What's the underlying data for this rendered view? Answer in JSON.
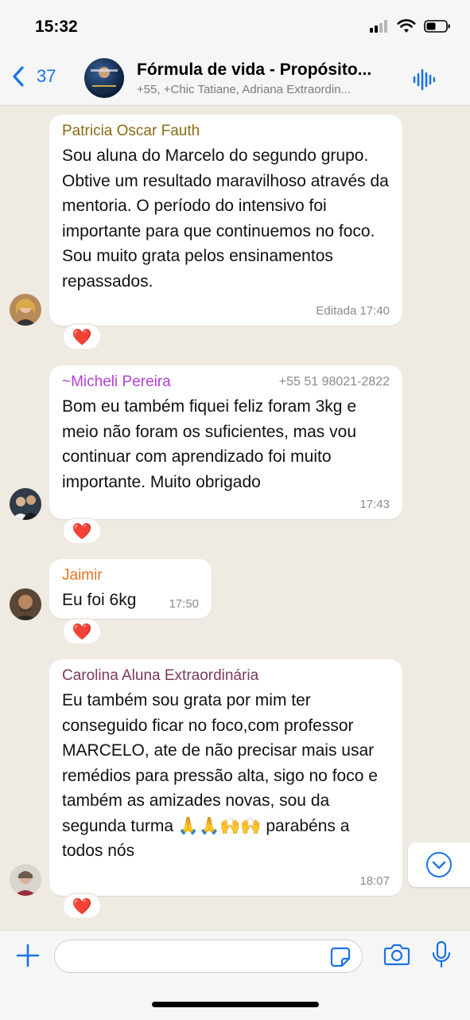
{
  "status": {
    "time": "15:32"
  },
  "header": {
    "back_count": "37",
    "title": "Fórmula de vida - Propósito...",
    "subtitle": "+55, +Chic Tatiane, Adriana Extraordin..."
  },
  "messages": [
    {
      "sender": "Patricia Oscar Fauth",
      "sender_color": "#8a6a12",
      "text": "Sou aluna do Marcelo do segundo grupo. Obtive um resultado maravilhoso através da mentoria. O período do intensivo foi importante para que continuemos no foco. Sou muito grata pelos ensinamentos repassados.",
      "meta": "Editada 17:40",
      "reaction": "❤️"
    },
    {
      "sender": "~Micheli Pereira",
      "sender_color": "#b43fd6",
      "phone": "+55 51 98021-2822",
      "text": "Bom eu também fiquei feliz foram 3kg e meio não foram os suficientes, mas vou continuar com aprendizado foi muito importante. Muito obrigado",
      "meta": "17:43",
      "reaction": "❤️"
    },
    {
      "sender": "Jaimir",
      "sender_color": "#e8731e",
      "text": "Eu foi 6kg",
      "meta": "17:50",
      "reaction": "❤️"
    },
    {
      "sender": "Carolina Aluna Extraordinária",
      "sender_color": "#7a3b57",
      "text": "Eu também sou grata por mim ter conseguido ficar no foco,com professor MARCELO, ate de não precisar mais usar remédios para pressão alta, sigo no foco  e também as amizades novas, sou da segunda turma 🙏🙏🙌🙌 parabéns a todos nós",
      "meta": "18:07",
      "reaction": "❤️"
    }
  ],
  "composer": {
    "placeholder": ""
  },
  "icons": {
    "back": "chevron-left-icon",
    "audio": "waveform-icon",
    "scroll": "chevron-down-icon",
    "plus": "plus-icon",
    "sticker": "sticker-icon",
    "camera": "camera-icon",
    "mic": "microphone-icon"
  },
  "colors": {
    "accent": "#1a73e8",
    "chat_bg": "#efeae2",
    "reaction": "#e0253b"
  }
}
